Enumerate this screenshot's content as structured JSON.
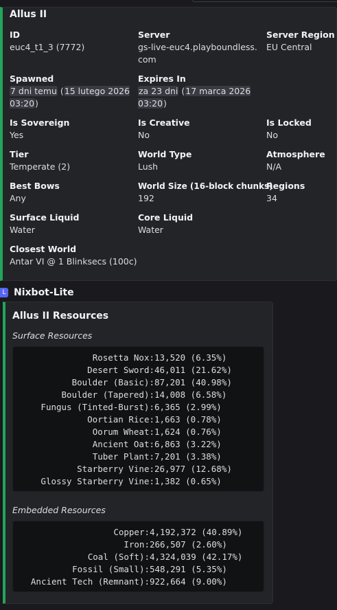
{
  "embed1": {
    "title": "Allus II",
    "fields": [
      {
        "name": "ID",
        "value": "euc4_t1_3 (7772)"
      },
      {
        "name": "Server",
        "value": "gs-live-euc4.playboundless.com"
      },
      {
        "name": "Server Region",
        "value": "EU Central"
      },
      {
        "name": "Spawned",
        "value_hl1": "7 dni temu",
        "value_mid": " (",
        "value_hl2": "15 lutego 2026 03:20",
        "value_end": ")"
      },
      {
        "name": "Expires In",
        "value_hl1": "za 23 dni",
        "value_mid": " (",
        "value_hl2": "17 marca 2026 03:20",
        "value_end": ")"
      },
      {
        "name": "Is Sovereign",
        "value": "Yes"
      },
      {
        "name": "Is Creative",
        "value": "No"
      },
      {
        "name": "Is Locked",
        "value": "No"
      },
      {
        "name": "Tier",
        "value": "Temperate (2)"
      },
      {
        "name": "World Type",
        "value": "Lush"
      },
      {
        "name": "Atmosphere",
        "value": "N/A"
      },
      {
        "name": "Best Bows",
        "value": "Any"
      },
      {
        "name": "World Size (16-block chunks)",
        "value": "192"
      },
      {
        "name": "Regions",
        "value": "34"
      },
      {
        "name": "Surface Liquid",
        "value": "Water"
      },
      {
        "name": "Core Liquid",
        "value": "Water"
      },
      {
        "name": "Closest World",
        "value": "Antar VI @ 1 Blinksecs (100c)"
      }
    ]
  },
  "bot": {
    "avatar": "L",
    "name": "Nixbot-Lite"
  },
  "embed2": {
    "title": "Allus II Resources",
    "surface_label": "Surface Resources",
    "surface": [
      {
        "k": "Rosetta Nox:",
        "v": "13,520 (6.35%)"
      },
      {
        "k": "Desert Sword:",
        "v": "46,011 (21.62%)"
      },
      {
        "k": "Boulder (Basic):",
        "v": "87,201 (40.98%)"
      },
      {
        "k": "Boulder (Tapered):",
        "v": "14,008 (6.58%)"
      },
      {
        "k": "Fungus (Tinted-Burst):",
        "v": "6,365 (2.99%)"
      },
      {
        "k": "Oortian Rice:",
        "v": "1,663 (0.78%)"
      },
      {
        "k": "Oorum Wheat:",
        "v": "1,624 (0.76%)"
      },
      {
        "k": "Ancient Oat:",
        "v": "6,863 (3.22%)"
      },
      {
        "k": "Tuber Plant:",
        "v": "7,201 (3.38%)"
      },
      {
        "k": "Starberry Vine:",
        "v": "26,977 (12.68%)"
      },
      {
        "k": "Glossy Starberry Vine:",
        "v": "1,382 (0.65%)"
      }
    ],
    "embedded_label": "Embedded Resources",
    "embedded": [
      {
        "k": "Copper:",
        "v": "4,192,372 (40.89%)"
      },
      {
        "k": "Iron:",
        "v": "266,507 (2.60%)"
      },
      {
        "k": "Coal (Soft):",
        "v": "4,324,039 (42.17%)"
      },
      {
        "k": "Fossil (Small):",
        "v": "548,291 (5.35%)"
      },
      {
        "k": "Ancient Tech (Remnant):",
        "v": "922,664 (9.00%)"
      }
    ]
  },
  "colors": {
    "accent": "#23a55a",
    "bot_avatar": "#5865f2",
    "background": "#1a1a1e",
    "embed": "#232428"
  }
}
